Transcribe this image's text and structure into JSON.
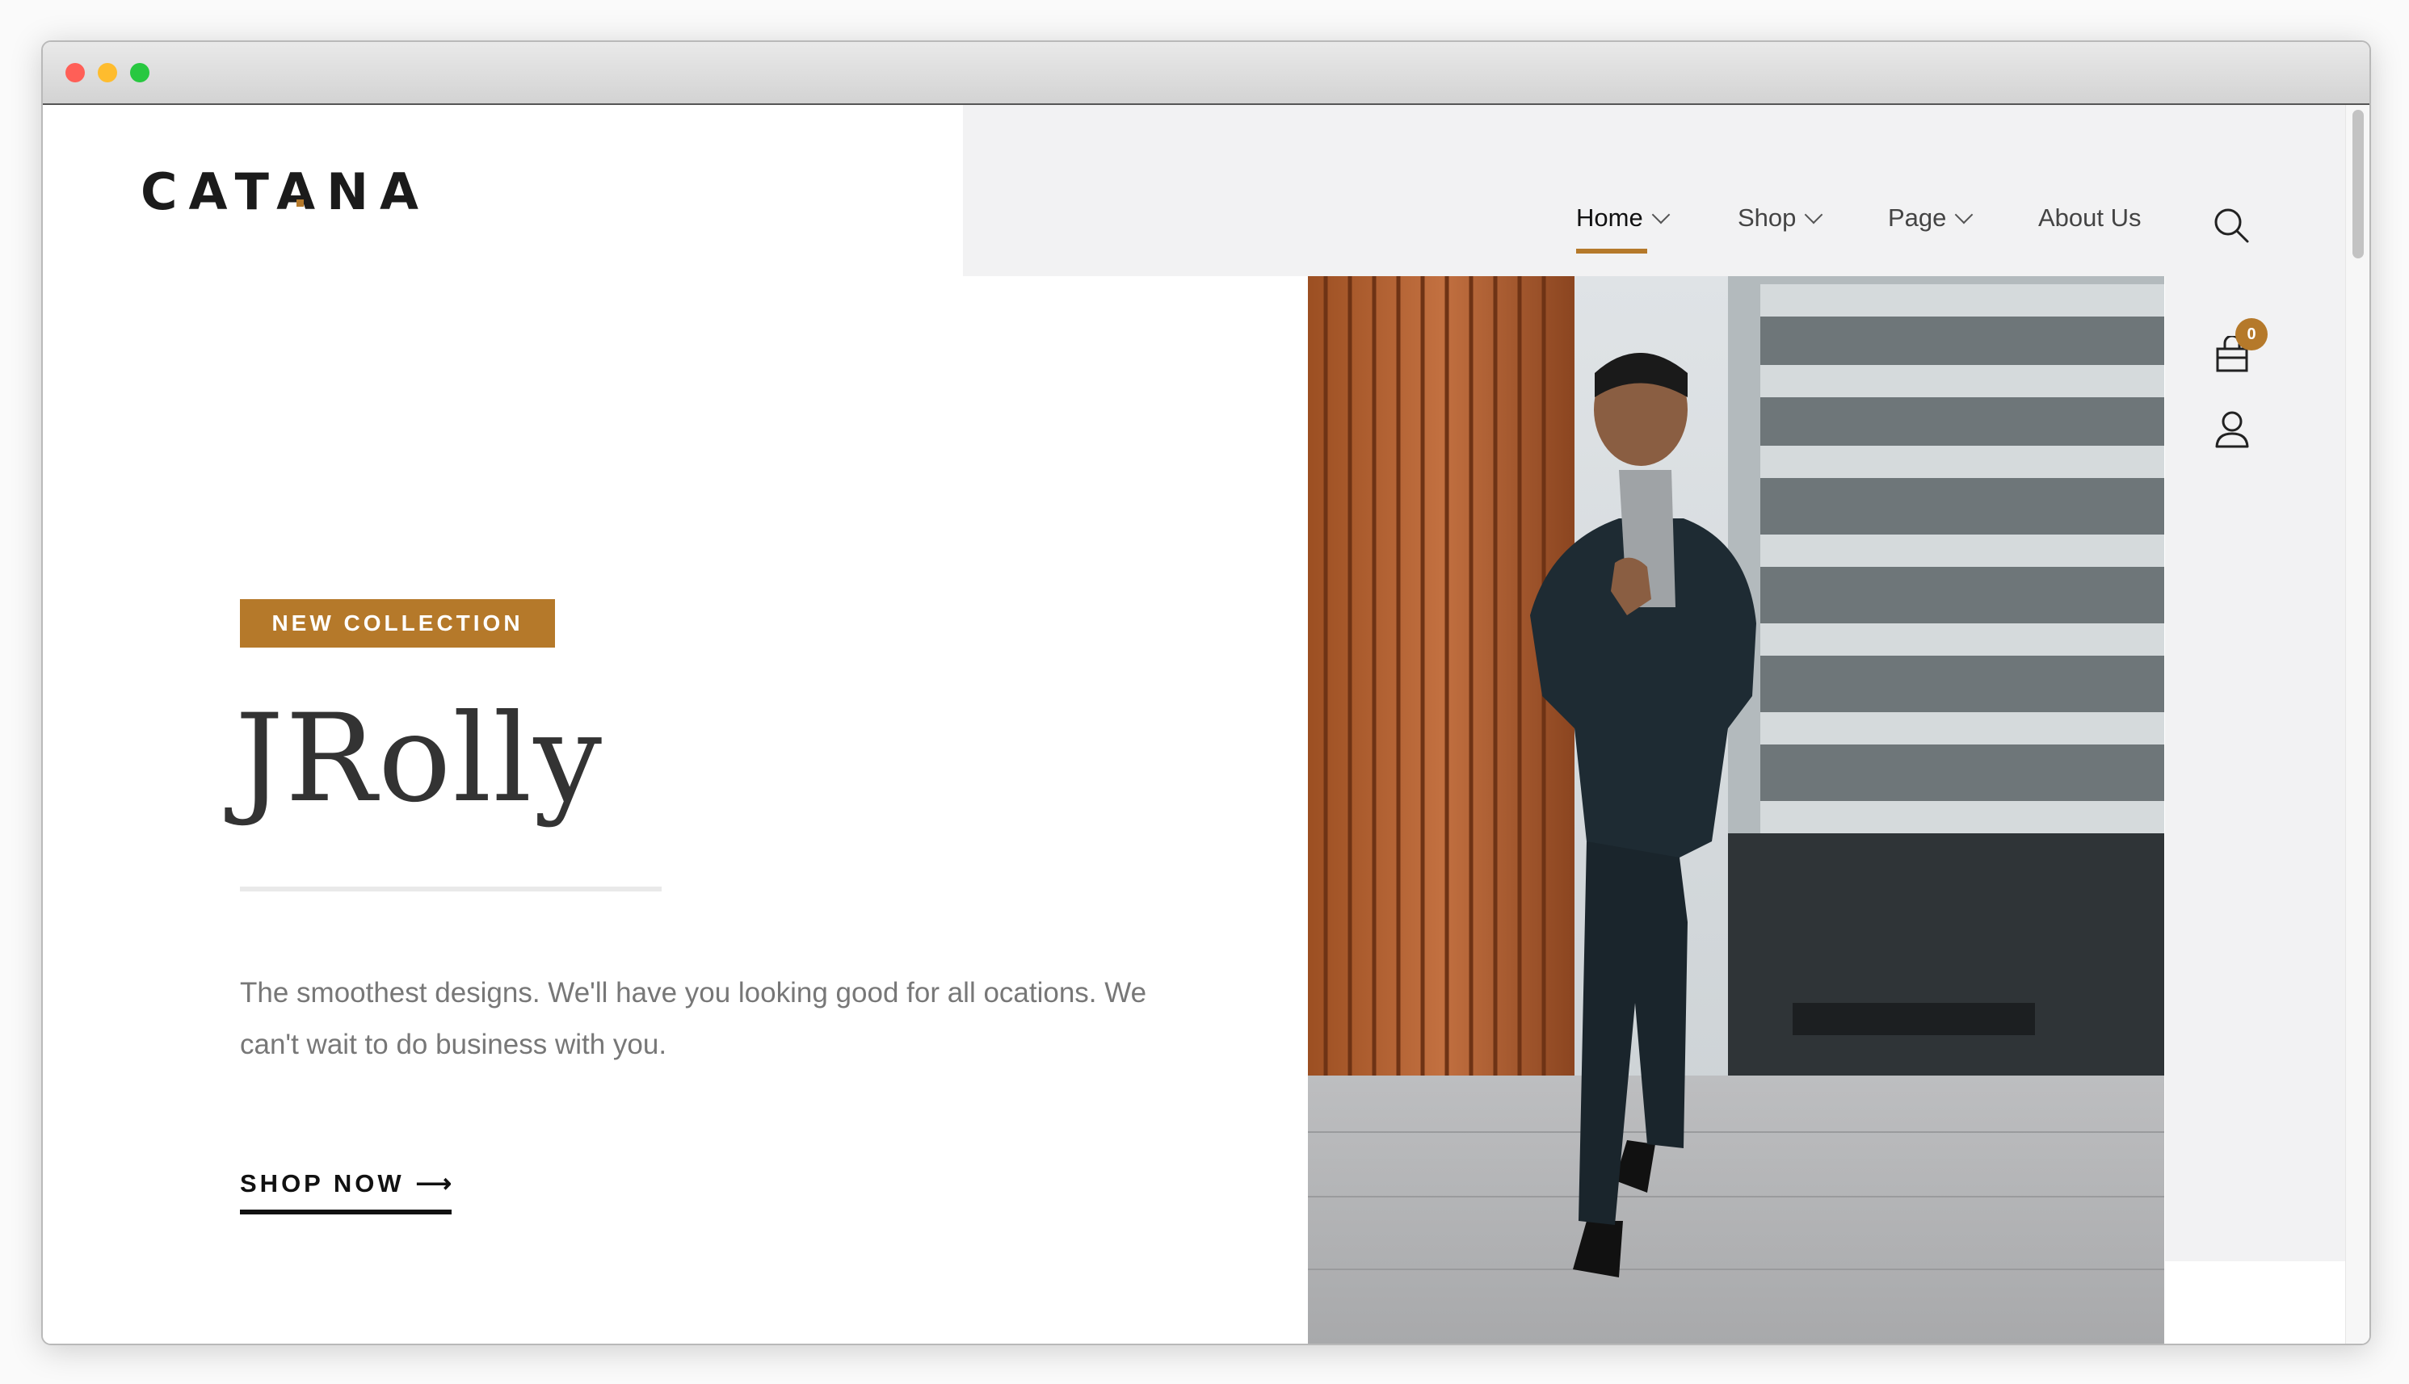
{
  "window": {
    "controls": [
      "close",
      "minimize",
      "zoom"
    ],
    "colors": {
      "close": "#ff5f57",
      "minimize": "#febc2e",
      "zoom": "#28c840"
    }
  },
  "brand": {
    "logo_text": "CATANA",
    "accent": "#b5792a"
  },
  "nav": {
    "items": [
      {
        "label": "Home",
        "has_dropdown": true,
        "active": true
      },
      {
        "label": "Shop",
        "has_dropdown": true,
        "active": false
      },
      {
        "label": "Page",
        "has_dropdown": true,
        "active": false
      },
      {
        "label": "About Us",
        "has_dropdown": false,
        "active": false
      }
    ],
    "icons": [
      "search-icon",
      "cart-icon",
      "user-icon"
    ],
    "cart_count": "0"
  },
  "hero": {
    "tag": "NEW COLLECTION",
    "title": "JRolly",
    "description": "The smoothest designs. We'll have you looking good for all ocations. We can't wait to do business with you.",
    "cta": "SHOP NOW",
    "cta_arrow": "⟶"
  }
}
